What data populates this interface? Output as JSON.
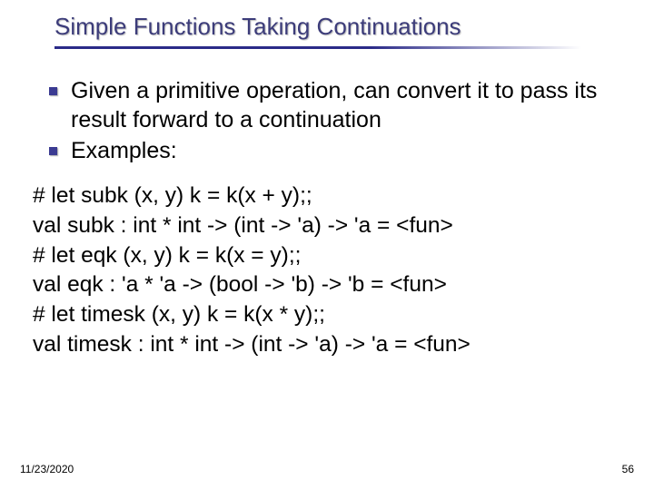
{
  "title": "Simple Functions Taking Continuations",
  "bullets": [
    "Given a primitive operation, can convert it to pass its result forward to a continuation",
    "Examples:"
  ],
  "code": [
    "# let subk (x, y) k = k(x + y);;",
    "val subk : int * int -> (int -> 'a) -> 'a = <fun>",
    "# let eqk (x, y) k = k(x = y);;",
    "val eqk : 'a * 'a -> (bool -> 'b) -> 'b = <fun>",
    "# let timesk (x, y) k = k(x * y);;",
    "val timesk : int * int -> (int -> 'a) -> 'a = <fun>"
  ],
  "footer_date": "11/23/2020",
  "page_number": "56"
}
